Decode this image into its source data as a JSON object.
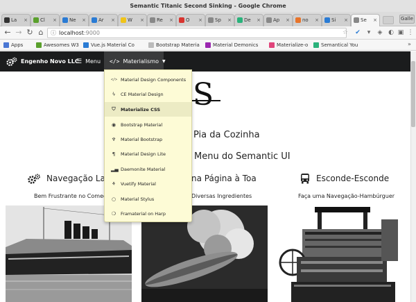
{
  "window": {
    "title": "Semantic Titanic Second Sinking - Google Chrome",
    "user": "Galle"
  },
  "tabs": [
    {
      "label": "La",
      "color": "#333333"
    },
    {
      "label": "Cl",
      "color": "#5aa02c"
    },
    {
      "label": "Ne",
      "color": "#2a7bd4"
    },
    {
      "label": "Ar",
      "color": "#2a7bd4"
    },
    {
      "label": "W",
      "color": "#f0c419"
    },
    {
      "label": "Re",
      "color": "#888888"
    },
    {
      "label": "O",
      "color": "#d8342f"
    },
    {
      "label": "Sp",
      "color": "#888888"
    },
    {
      "label": "De",
      "color": "#2ab27b"
    },
    {
      "label": "Ap",
      "color": "#888888"
    },
    {
      "label": "no",
      "color": "#e8742a"
    },
    {
      "label": "Si",
      "color": "#2a7bd4"
    },
    {
      "label": "Se",
      "color": "#888888"
    }
  ],
  "address": {
    "host": "localhost",
    "port": ":9000"
  },
  "bookmarks": [
    {
      "label": "Apps",
      "color": "#4a77d4"
    },
    {
      "label": "Awesomes W3",
      "color": "#5aa02c"
    },
    {
      "label": "Vue.js Material Co",
      "color": "#2a7bd4"
    },
    {
      "label": "Bootstrap Materia",
      "color": "#bbbbbb"
    },
    {
      "label": "Material Demonics",
      "color": "#9b27b0"
    },
    {
      "label": "Materialize-o",
      "color": "#e0457b"
    },
    {
      "label": "Semantical You",
      "color": "#2ab27b"
    }
  ],
  "appbar": {
    "brand": "Engenho Novo LLC",
    "menu_label": "Menu",
    "materialismo_label": "Materialismo"
  },
  "hero": {
    "letter": "S",
    "line1": "s a Pia da Cozinha",
    "line2": "Menu do Semantic UI"
  },
  "columns": [
    {
      "title": "Navegação Later",
      "subtitle": "Bem Frustrante no Começo",
      "icon": "gears-icon"
    },
    {
      "title": "na Página à Toa",
      "subtitle": "Diversas Ingredientes",
      "icon": ""
    },
    {
      "title": "Esconde-Esconde",
      "subtitle": "Faça uma Navegação-Hambúrguer",
      "icon": "bus-icon"
    }
  ],
  "dropdown": {
    "items": [
      {
        "label": "Material Design Components",
        "icon": "code-icon"
      },
      {
        "label": "CE Material Design",
        "icon": "bolt-icon"
      },
      {
        "label": "Materialize CSS",
        "icon": "shield-icon"
      },
      {
        "label": "Bootstrap Material",
        "icon": "github-icon"
      },
      {
        "label": "Material Bootstrap",
        "icon": "mic-icon"
      },
      {
        "label": "Material Design Lite",
        "icon": "paragraph-icon"
      },
      {
        "label": "Daemonite Material",
        "icon": "signal-icon"
      },
      {
        "label": "Vuetify Material",
        "icon": "sitemap-icon"
      },
      {
        "label": "Material Stylus",
        "icon": "chat-icon"
      },
      {
        "label": "Framaterial on Harp",
        "icon": "comments-icon"
      }
    ],
    "selected_index": 2
  }
}
